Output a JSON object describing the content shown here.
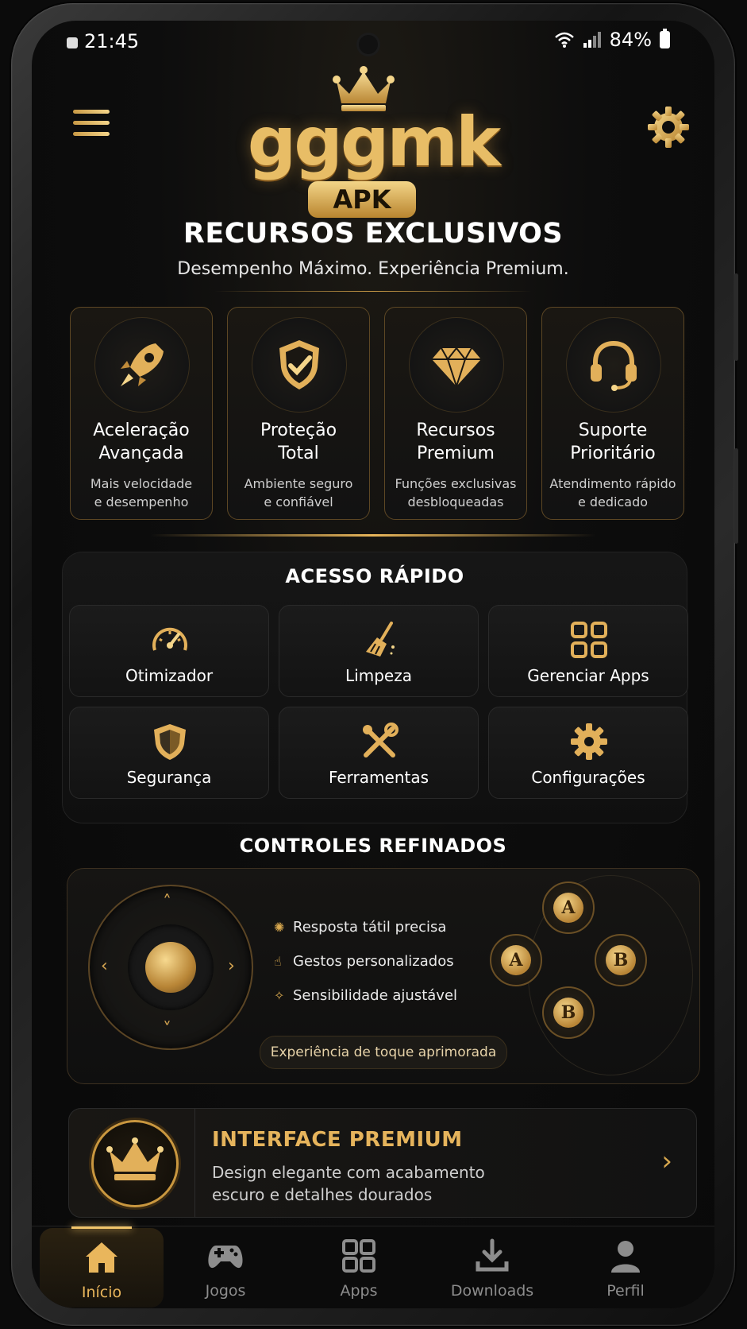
{
  "status_bar": {
    "time": "21:45",
    "battery": "84%"
  },
  "header": {
    "brand": "gggmk",
    "badge": "APK"
  },
  "hero": {
    "title": "RECURSOS EXCLUSIVOS",
    "subtitle": "Desempenho Máximo. Experiência Premium."
  },
  "features": [
    {
      "title1": "Aceleração",
      "title2": "Avançada",
      "desc1": "Mais velocidade",
      "desc2": "e desempenho",
      "icon": "rocket-icon"
    },
    {
      "title1": "Proteção",
      "title2": "Total",
      "desc1": "Ambiente seguro",
      "desc2": "e confiável",
      "icon": "shield-check-icon"
    },
    {
      "title1": "Recursos",
      "title2": "Premium",
      "desc1": "Funções exclusivas",
      "desc2": "desbloqueadas",
      "icon": "diamond-icon"
    },
    {
      "title1": "Suporte",
      "title2": "Prioritário",
      "desc1": "Atendimento rápido",
      "desc2": "e dedicado",
      "icon": "headset-icon"
    }
  ],
  "quick_access": {
    "title": "ACESSO RÁPIDO",
    "items": [
      {
        "label": "Otimizador",
        "icon": "speedometer-icon"
      },
      {
        "label": "Limpeza",
        "icon": "broom-icon"
      },
      {
        "label": "Gerenciar Apps",
        "icon": "apps-grid-icon"
      },
      {
        "label": "Segurança",
        "icon": "shield-icon"
      },
      {
        "label": "Ferramentas",
        "icon": "tools-icon"
      },
      {
        "label": "Configurações",
        "icon": "gear-icon"
      }
    ]
  },
  "controls": {
    "title": "CONTROLES REFINADOS",
    "features": [
      "Resposta tátil precisa",
      "Gestos personalizados",
      "Sensibilidade ajustável"
    ],
    "pill": "Experiência de toque aprimorada",
    "buttons": {
      "top": "A",
      "left": "A",
      "right": "B",
      "bottom": "B"
    }
  },
  "premium": {
    "title": "INTERFACE PREMIUM",
    "desc1": "Design elegante com acabamento",
    "desc2": "escuro e detalhes dourados"
  },
  "bottom_nav": [
    {
      "label": "Início",
      "icon": "home-icon",
      "active": true
    },
    {
      "label": "Jogos",
      "icon": "gamepad-icon",
      "active": false
    },
    {
      "label": "Apps",
      "icon": "apps-icon",
      "active": false
    },
    {
      "label": "Downloads",
      "icon": "download-icon",
      "active": false
    },
    {
      "label": "Perfil",
      "icon": "profile-icon",
      "active": false
    }
  ],
  "colors": {
    "gold": "#e6b45c",
    "gold_light": "#f4d58a",
    "background": "#0b0b0b"
  }
}
